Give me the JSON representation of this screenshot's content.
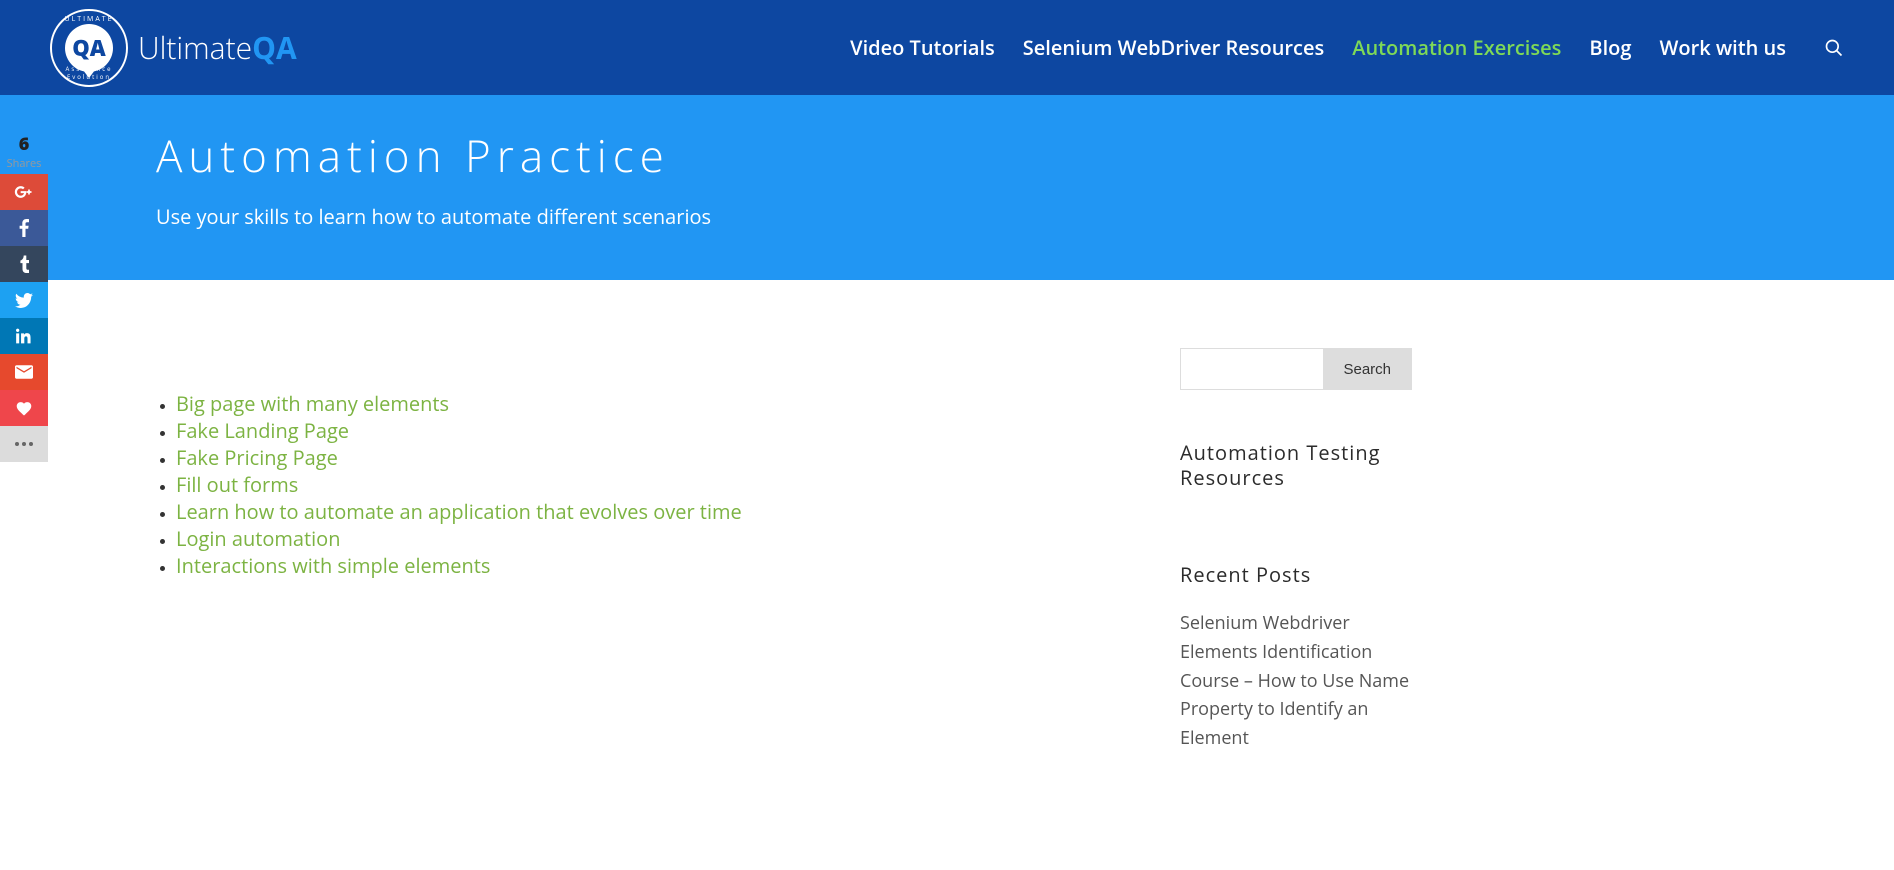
{
  "header": {
    "brand_text_a": "Ultimate",
    "brand_text_b": "QA",
    "logo_top": "ULTIMATE",
    "logo_bot": "Quality Assurance Evolution",
    "logo_inner": "QA",
    "nav": [
      {
        "label": "Video Tutorials",
        "active": false
      },
      {
        "label": "Selenium WebDriver Resources",
        "active": false
      },
      {
        "label": "Automation Exercises",
        "active": true
      },
      {
        "label": "Blog",
        "active": false
      },
      {
        "label": "Work with us",
        "active": false
      }
    ]
  },
  "hero": {
    "title": "Automation Practice",
    "subtitle": "Use your skills to learn how to automate different scenarios"
  },
  "links": [
    "Big page with many elements",
    "Fake Landing Page",
    "Fake Pricing Page",
    "Fill out forms",
    "Learn how to automate an application that evolves over time",
    "Login automation",
    "Interactions with simple elements"
  ],
  "sidebar": {
    "search_button": "Search",
    "h1": "Automation Testing Resources",
    "h2": "Recent Posts",
    "recent": "Selenium Webdriver Elements Identification Course – How to Use Name Property to Identify an Element"
  },
  "social": {
    "count": "6",
    "label": "Shares"
  }
}
